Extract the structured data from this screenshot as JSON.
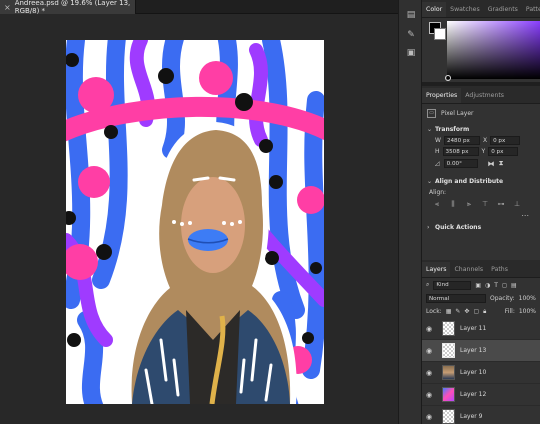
{
  "document_tab": {
    "title": "Andreea.psd @ 19.6% (Layer 13, RGB/8) *",
    "close": "×"
  },
  "panel_tabs": [
    "Color",
    "Swatches",
    "Gradients",
    "Patter"
  ],
  "colors": {
    "foreground": "#000000",
    "background": "#ffffff",
    "picker_hue": "#8a3fff"
  },
  "properties": {
    "tabs": [
      "Properties",
      "Adjustments"
    ],
    "kind": "Pixel Layer",
    "transform": {
      "heading": "Transform",
      "w_label": "W",
      "w": "2480 px",
      "x_label": "X",
      "x": "0 px",
      "h_label": "H",
      "h": "3508 px",
      "y_label": "Y",
      "y": "0 px",
      "angle": "0.00°"
    },
    "align": {
      "heading": "Align and Distribute",
      "label": "Align:"
    },
    "more": "...",
    "quick_actions": "Quick Actions"
  },
  "layers_panel": {
    "tabs": [
      "Layers",
      "Channels",
      "Paths"
    ],
    "filter_kind": "Kind",
    "blend_mode": "Normal",
    "opacity_label": "Opacity:",
    "opacity": "100%",
    "lock_label": "Lock:",
    "fill_label": "Fill:",
    "fill": "100%",
    "layers": [
      {
        "name": "Layer 11",
        "thumb": "transparent",
        "selected": false
      },
      {
        "name": "Layer 13",
        "thumb": "transparent",
        "selected": true
      },
      {
        "name": "Layer 10",
        "thumb": "photo",
        "selected": false
      },
      {
        "name": "Layer 12",
        "thumb": "art",
        "selected": false
      },
      {
        "name": "Layer 9",
        "thumb": "transparent",
        "selected": false
      }
    ]
  }
}
